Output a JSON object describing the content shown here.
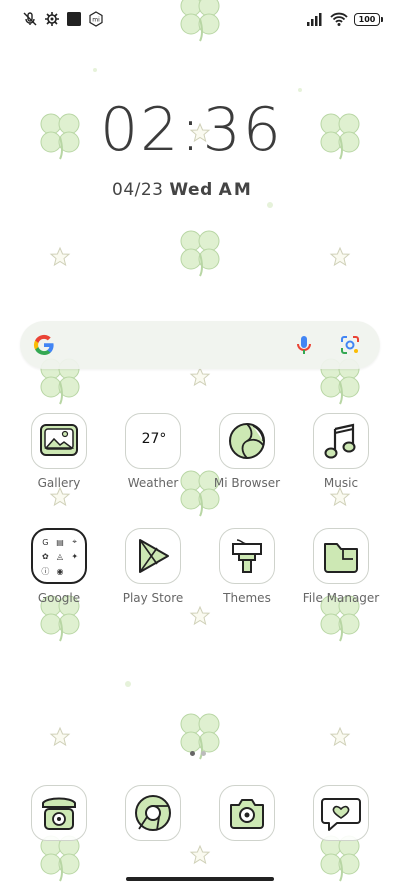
{
  "status_bar": {
    "left_icons": [
      "mic-off-icon",
      "gear-icon",
      "square-icon",
      "mi-icon"
    ],
    "battery": "100",
    "right_icons": [
      "signal-icon",
      "wifi-icon"
    ]
  },
  "clock": {
    "time": "02:36",
    "date": "04/23",
    "weekday": "Wed",
    "ampm": "AM"
  },
  "search_bar": {
    "logo": "google-g-icon",
    "mic_icon": "mic-icon",
    "lens_icon": "lens-icon"
  },
  "apps": [
    {
      "label": "Gallery",
      "icon": "gallery-icon"
    },
    {
      "label": "Weather",
      "icon": "weather-icon",
      "temp": "27°"
    },
    {
      "label": "Mi Browser",
      "icon": "browser-icon"
    },
    {
      "label": "Music",
      "icon": "music-icon"
    },
    {
      "label": "Google",
      "icon": "folder-icon"
    },
    {
      "label": "Play Store",
      "icon": "play-store-icon"
    },
    {
      "label": "Themes",
      "icon": "themes-icon"
    },
    {
      "label": "File Manager",
      "icon": "file-manager-icon"
    }
  ],
  "dock": [
    {
      "icon": "phone-icon"
    },
    {
      "icon": "chrome-icon"
    },
    {
      "icon": "camera-icon"
    },
    {
      "icon": "messages-icon"
    }
  ],
  "pager": {
    "pages": 2,
    "current": 1
  },
  "colors": {
    "clover": "#d8ecc8",
    "icon_fill": "#cde8b4",
    "outline": "#222222"
  }
}
